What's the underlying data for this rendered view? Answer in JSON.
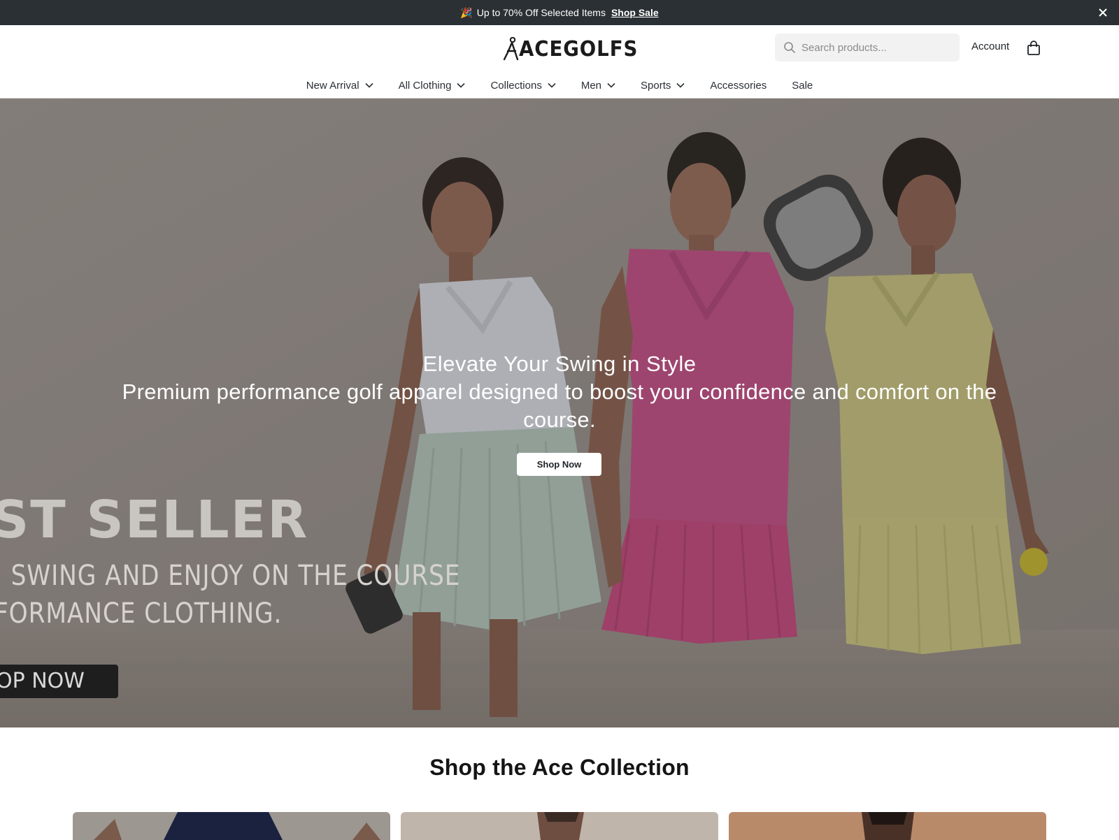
{
  "announcement": {
    "emoji": "🎉",
    "text": "Up to 70% Off Selected Items",
    "link": "Shop Sale",
    "close_icon": "close-icon"
  },
  "header": {
    "logo": "ACEGOLFS",
    "search_placeholder": "Search products...",
    "account_label": "Account",
    "bag_icon": "shopping-bag-icon"
  },
  "nav": {
    "items": [
      {
        "label": "New Arrival",
        "has_dropdown": true
      },
      {
        "label": "All Clothing",
        "has_dropdown": true
      },
      {
        "label": "Collections",
        "has_dropdown": true
      },
      {
        "label": "Men",
        "has_dropdown": true
      },
      {
        "label": "Sports",
        "has_dropdown": true
      },
      {
        "label": "Accessories",
        "has_dropdown": false
      },
      {
        "label": "Sale",
        "has_dropdown": false
      }
    ]
  },
  "hero": {
    "title": "Elevate Your Swing in Style",
    "subtitle": "Premium performance golf apparel designed to boost your confidence and comfort on the course.",
    "button": "Shop Now",
    "promo_headline": "ST SELLER",
    "promo_line1": ", SWING AND ENJOY ON THE COURSE",
    "promo_line2": "FORMANCE CLOTHING.",
    "promo_button": "OP NOW"
  },
  "collection": {
    "title": "Shop the Ace Collection"
  },
  "colors": {
    "announcement_bg": "#2b3034",
    "hero_overlay": "#8d8782",
    "shirt_white": "#d9dce4",
    "shirt_pink": "#e05a9a",
    "shirt_yellow": "#e3df8c",
    "skirt_mint": "#b9d4c6",
    "skirt_pink": "#e0548d",
    "skirt_yellow": "#e6e08f"
  }
}
